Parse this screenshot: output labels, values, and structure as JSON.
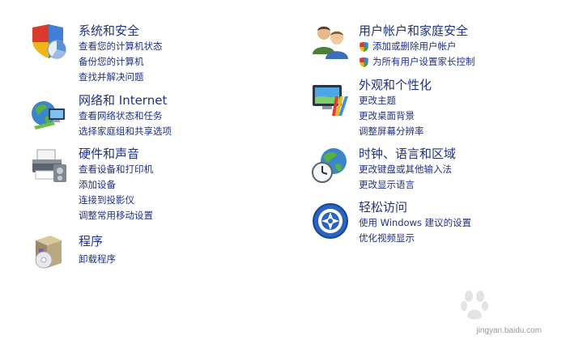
{
  "categories": [
    {
      "title": "系统和安全",
      "links": [
        "查看您的计算机状态",
        "备份您的计算机",
        "查找并解决问题"
      ]
    },
    {
      "title": "网络和 Internet",
      "links": [
        "查看网络状态和任务",
        "选择家庭组和共享选项"
      ]
    },
    {
      "title": "硬件和声音",
      "links": [
        "查看设备和打印机",
        "添加设备",
        "连接到投影仪",
        "调整常用移动设置"
      ]
    },
    {
      "title": "程序",
      "links": [
        "卸载程序"
      ]
    },
    {
      "title": "用户帐户和家庭安全",
      "links": [
        "添加或删除用户帐户",
        "为所有用户设置家长控制"
      ]
    },
    {
      "title": "外观和个性化",
      "links": [
        "更改主题",
        "更改桌面背景",
        "调整屏幕分辨率"
      ]
    },
    {
      "title": "时钟、语言和区域",
      "links": [
        "更改键盘或其他输入法",
        "更改显示语言"
      ]
    },
    {
      "title": "轻松访问",
      "links": [
        "使用 Windows 建议的设置",
        "优化视频显示"
      ]
    }
  ],
  "watermark": {
    "logo": "Baidu经验",
    "url": "jingyan.baidu.com"
  },
  "colors": {
    "link": "#1e3287",
    "background": "#ffffff"
  }
}
